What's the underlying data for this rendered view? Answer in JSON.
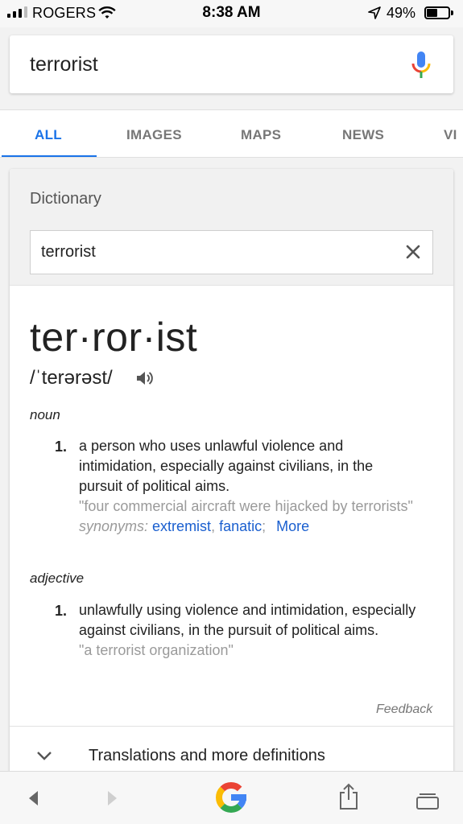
{
  "status_bar": {
    "carrier": "ROGERS",
    "time": "8:38 AM",
    "battery": "49%"
  },
  "search": {
    "query": "terrorist",
    "mic_icon": "microphone-icon"
  },
  "tabs": [
    {
      "label": "ALL",
      "active": true
    },
    {
      "label": "IMAGES",
      "active": false
    },
    {
      "label": "MAPS",
      "active": false
    },
    {
      "label": "NEWS",
      "active": false
    },
    {
      "label": "VI",
      "active": false
    }
  ],
  "dictionary": {
    "title": "Dictionary",
    "input_value": "terrorist",
    "headword": "ter·ror·ist",
    "phonetic": "/ˈterərəst/",
    "entries": [
      {
        "pos": "noun",
        "number": "1.",
        "definition": "a person who uses unlawful violence and intimidation, especially against civilians, in the pursuit of political aims.",
        "example": "\"four commercial aircraft were hijacked by terrorists\"",
        "synonyms_label": "synonyms:",
        "synonyms": [
          "extremist",
          "fanatic"
        ],
        "more_label": "More"
      },
      {
        "pos": "adjective",
        "number": "1.",
        "definition": "unlawfully using violence and intimidation, especially against civilians, in the pursuit of political aims.",
        "example": "\"a terrorist organization\""
      }
    ],
    "feedback": "Feedback",
    "more_definitions": "Translations and more definitions"
  },
  "colors": {
    "accent": "#1a73e8",
    "link": "#1a5fcf",
    "muted": "#9a9a9a"
  }
}
